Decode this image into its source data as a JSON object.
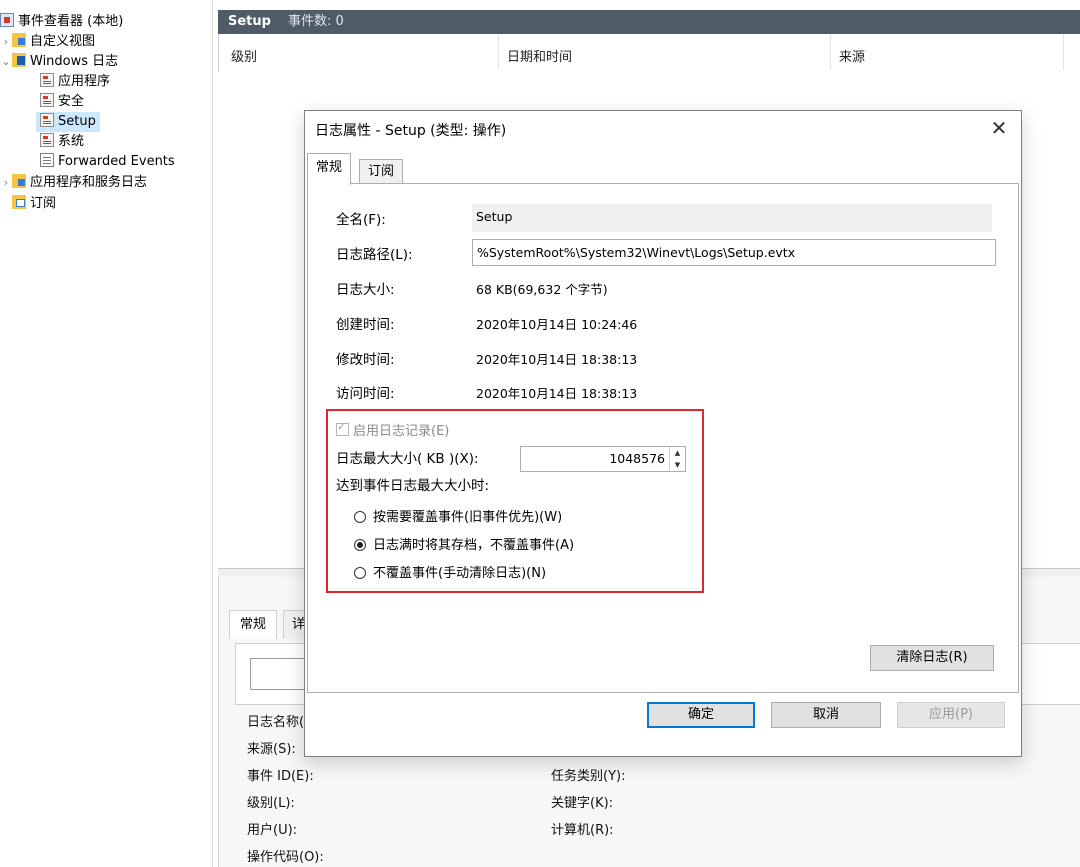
{
  "tree": {
    "root": "事件查看器 (本地)",
    "items": [
      {
        "label": "自定义视图"
      },
      {
        "label": "Windows 日志"
      },
      {
        "label": "应用程序"
      },
      {
        "label": "安全"
      },
      {
        "label": "Setup"
      },
      {
        "label": "系统"
      },
      {
        "label": "Forwarded Events"
      },
      {
        "label": "应用程序和服务日志"
      },
      {
        "label": "订阅"
      }
    ]
  },
  "main": {
    "title": "Setup",
    "count": "事件数: 0",
    "columns": [
      "级别",
      "日期和时间",
      "来源"
    ]
  },
  "detail": {
    "tabs": [
      "常规",
      "详"
    ],
    "fields_left": [
      "日志名称(",
      "来源(S):",
      "事件 ID(E):",
      "级别(L):",
      "用户(U):",
      "操作代码(O):"
    ],
    "fields_right": [
      "任务类别(Y):",
      "关键字(K):",
      "计算机(R):"
    ]
  },
  "dialog": {
    "title": "日志属性 - Setup (类型: 操作)",
    "tabs": [
      "常规",
      "订阅"
    ],
    "full_name_label": "全名(F):",
    "full_name_value": "Setup",
    "log_path_label": "日志路径(L):",
    "log_path_value": "%SystemRoot%\\System32\\Winevt\\Logs\\Setup.evtx",
    "log_size_label": "日志大小:",
    "log_size_value": "68 KB(69,632 个字节)",
    "created_label": "创建时间:",
    "created_value": "2020年10月14日 10:24:46",
    "modified_label": "修改时间:",
    "modified_value": "2020年10月14日 18:38:13",
    "accessed_label": "访问时间:",
    "accessed_value": "2020年10月14日 18:38:13",
    "enable_logging_label": "启用日志记录(E)",
    "max_size_label": "日志最大大小( KB )(X):",
    "max_size_value": "1048576",
    "when_max_label": "达到事件日志最大大小时:",
    "radio_overwrite": "按需要覆盖事件(旧事件优先)(W)",
    "radio_archive": "日志满时将其存档，不覆盖事件(A)",
    "radio_no_overwrite": "不覆盖事件(手动清除日志)(N)",
    "selected_option": "archive",
    "clear_button": "清除日志(R)",
    "ok_button": "确定",
    "cancel_button": "取消",
    "apply_button": "应用(P)",
    "close_glyph": "✕"
  },
  "colors": {
    "title_bar": "#4f5b67",
    "selection": "#cce8ff",
    "highlight_box": "#e0262e",
    "primary_border": "#0078d7"
  }
}
